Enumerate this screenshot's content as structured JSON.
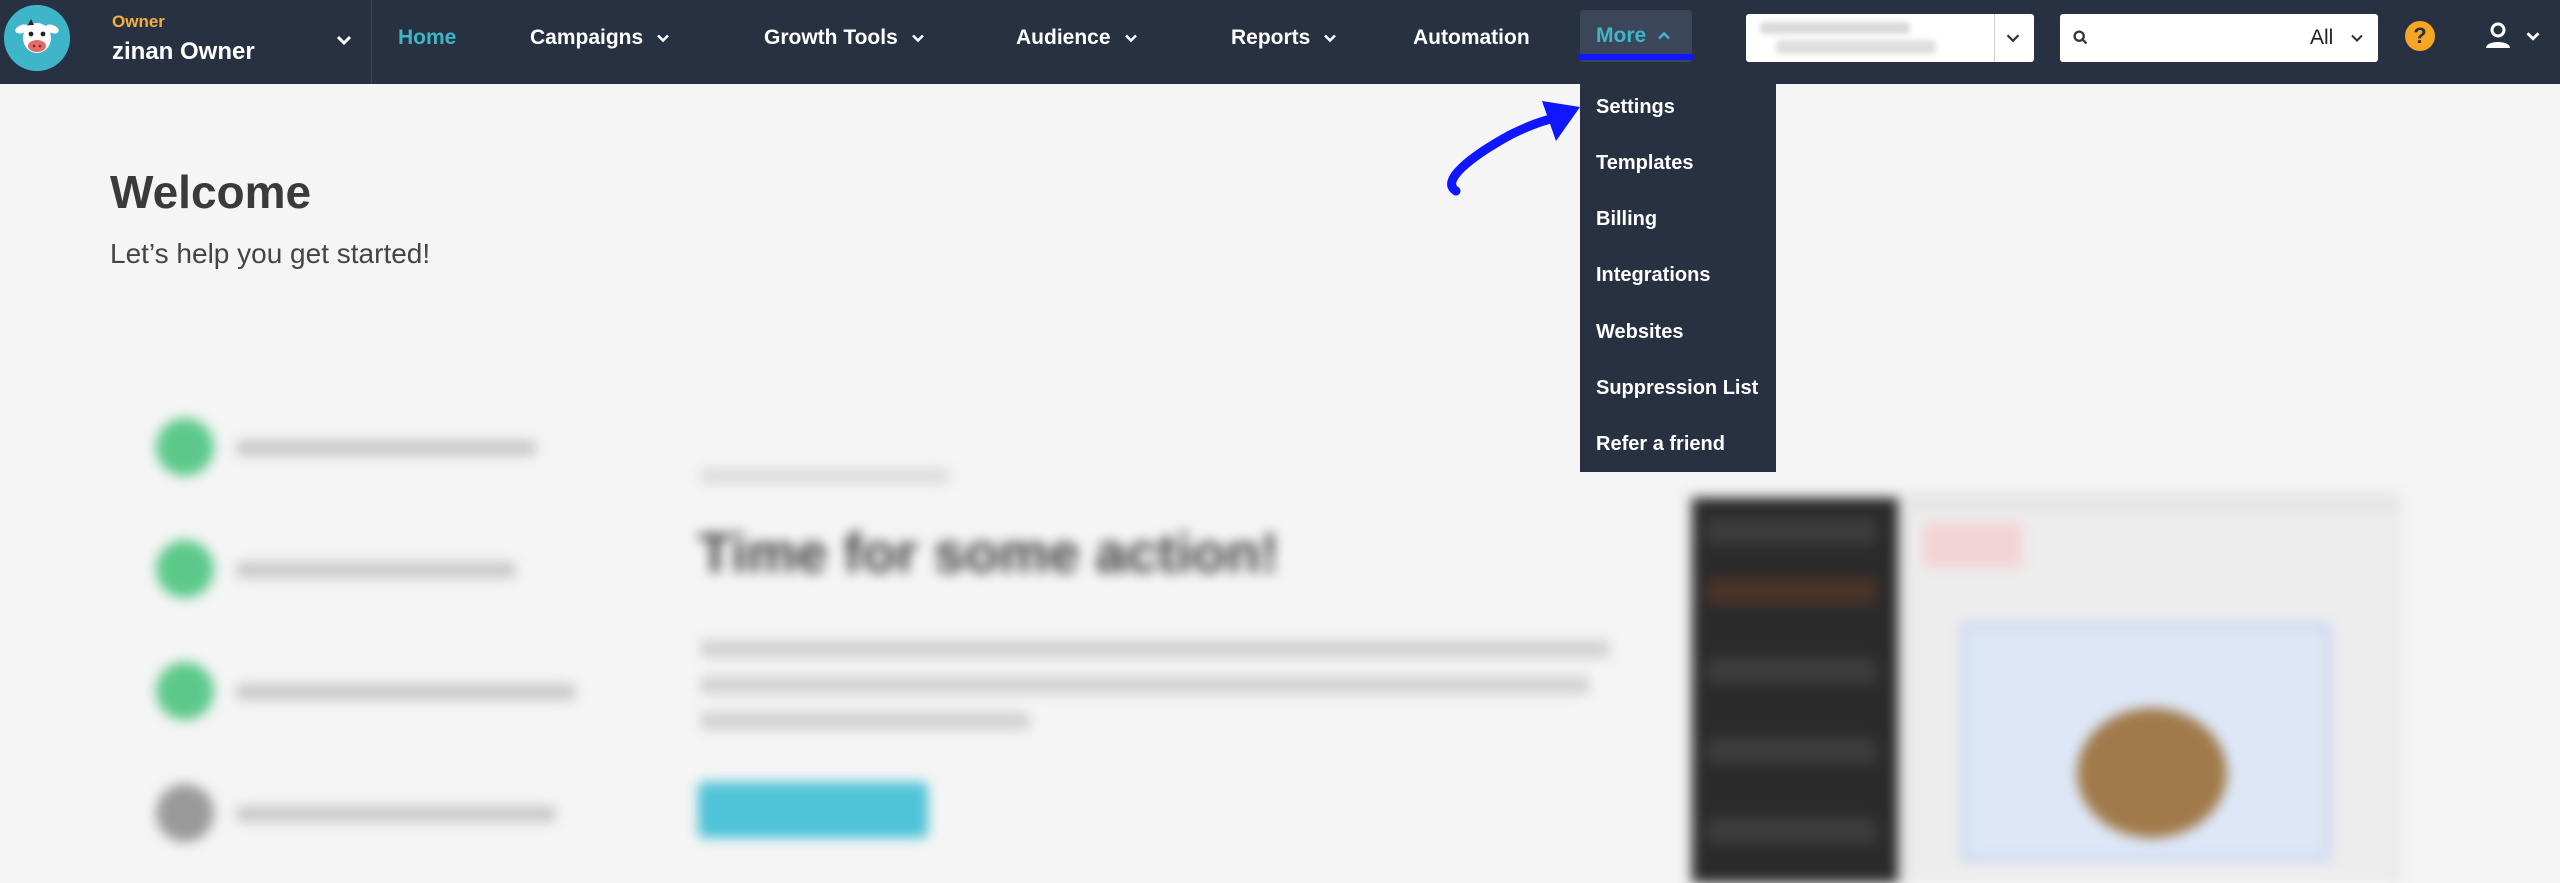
{
  "account": {
    "role": "Owner",
    "name": "zinan Owner"
  },
  "nav": {
    "items": [
      {
        "label": "Home",
        "active": true,
        "has_dropdown": false
      },
      {
        "label": "Campaigns",
        "active": false,
        "has_dropdown": true
      },
      {
        "label": "Growth Tools",
        "active": false,
        "has_dropdown": true
      },
      {
        "label": "Audience",
        "active": false,
        "has_dropdown": true
      },
      {
        "label": "Reports",
        "active": false,
        "has_dropdown": true
      },
      {
        "label": "Automation",
        "active": false,
        "has_dropdown": false
      }
    ],
    "more": {
      "label": "More",
      "expanded": true
    }
  },
  "search": {
    "placeholder": "",
    "filter": "All"
  },
  "more_menu": {
    "items": [
      "Settings",
      "Templates",
      "Billing",
      "Integrations",
      "Websites",
      "Suppression List",
      "Refer a friend"
    ]
  },
  "welcome": {
    "title": "Welcome",
    "subtitle": "Let’s help you get started!"
  },
  "action_card": {
    "title": "Time for some action!"
  },
  "colors": {
    "nav_bg": "#283142",
    "accent": "#3fb5c9",
    "annotation_arrow": "#1016ff",
    "help_badge": "#f5a623"
  },
  "icons": [
    "logo-cow-icon",
    "chevron-down-icon",
    "chevron-up-icon",
    "search-icon",
    "help-icon",
    "user-icon",
    "annotation-arrow-icon"
  ]
}
